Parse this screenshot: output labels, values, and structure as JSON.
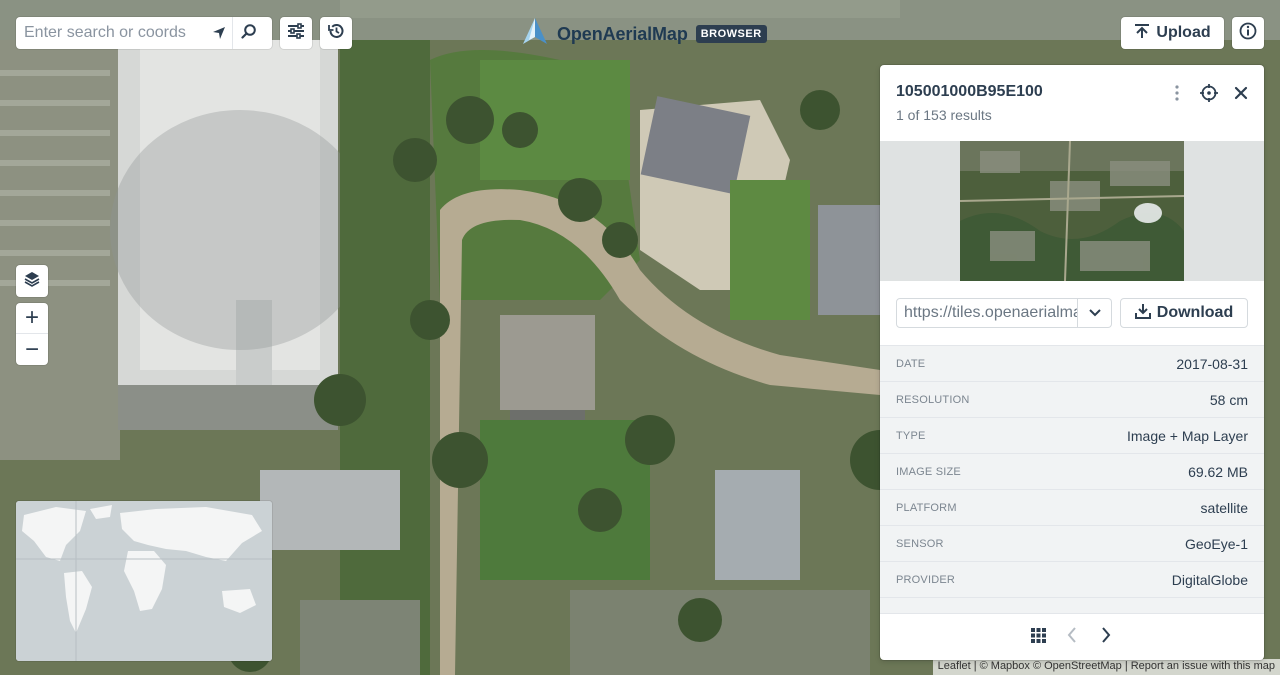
{
  "search": {
    "placeholder": "Enter search or coords"
  },
  "brand": {
    "name": "OpenAerialMap",
    "badge": "BROWSER"
  },
  "toolbar": {
    "upload_label": "Upload"
  },
  "zoom": {
    "in_label": "+",
    "out_label": "−"
  },
  "panel": {
    "title": "105001000B95E100",
    "results": "1 of 153 results",
    "tms_url": "https://tiles.openaerialmap.org/",
    "download_label": "Download",
    "metadata": [
      {
        "key": "DATE",
        "value": "2017-08-31"
      },
      {
        "key": "RESOLUTION",
        "value": "58 cm"
      },
      {
        "key": "TYPE",
        "value": "Image + Map Layer"
      },
      {
        "key": "IMAGE SIZE",
        "value": "69.62 MB"
      },
      {
        "key": "PLATFORM",
        "value": "satellite"
      },
      {
        "key": "SENSOR",
        "value": "GeoEye-1"
      },
      {
        "key": "PROVIDER",
        "value": "DigitalGlobe"
      }
    ]
  },
  "attribution": {
    "leaflet": "Leaflet",
    "mapbox": "| © Mapbox © OpenStreetMap |",
    "report": "Report an issue with this map"
  },
  "icons": {
    "locate": "location-arrow-icon",
    "search": "search-icon",
    "filters": "sliders-icon",
    "history": "history-icon",
    "upload": "upload-icon",
    "info": "info-icon",
    "layers": "layers-icon",
    "more": "more-vertical-icon",
    "target": "crosshair-icon",
    "close": "close-icon",
    "download": "download-icon",
    "grid": "grid-icon",
    "prev": "chevron-left-icon",
    "next": "chevron-right-icon"
  },
  "colors": {
    "primary": "#2d3e50",
    "panel_meta_bg": "#f1f3f4",
    "map_green": "#6f7a5c"
  }
}
